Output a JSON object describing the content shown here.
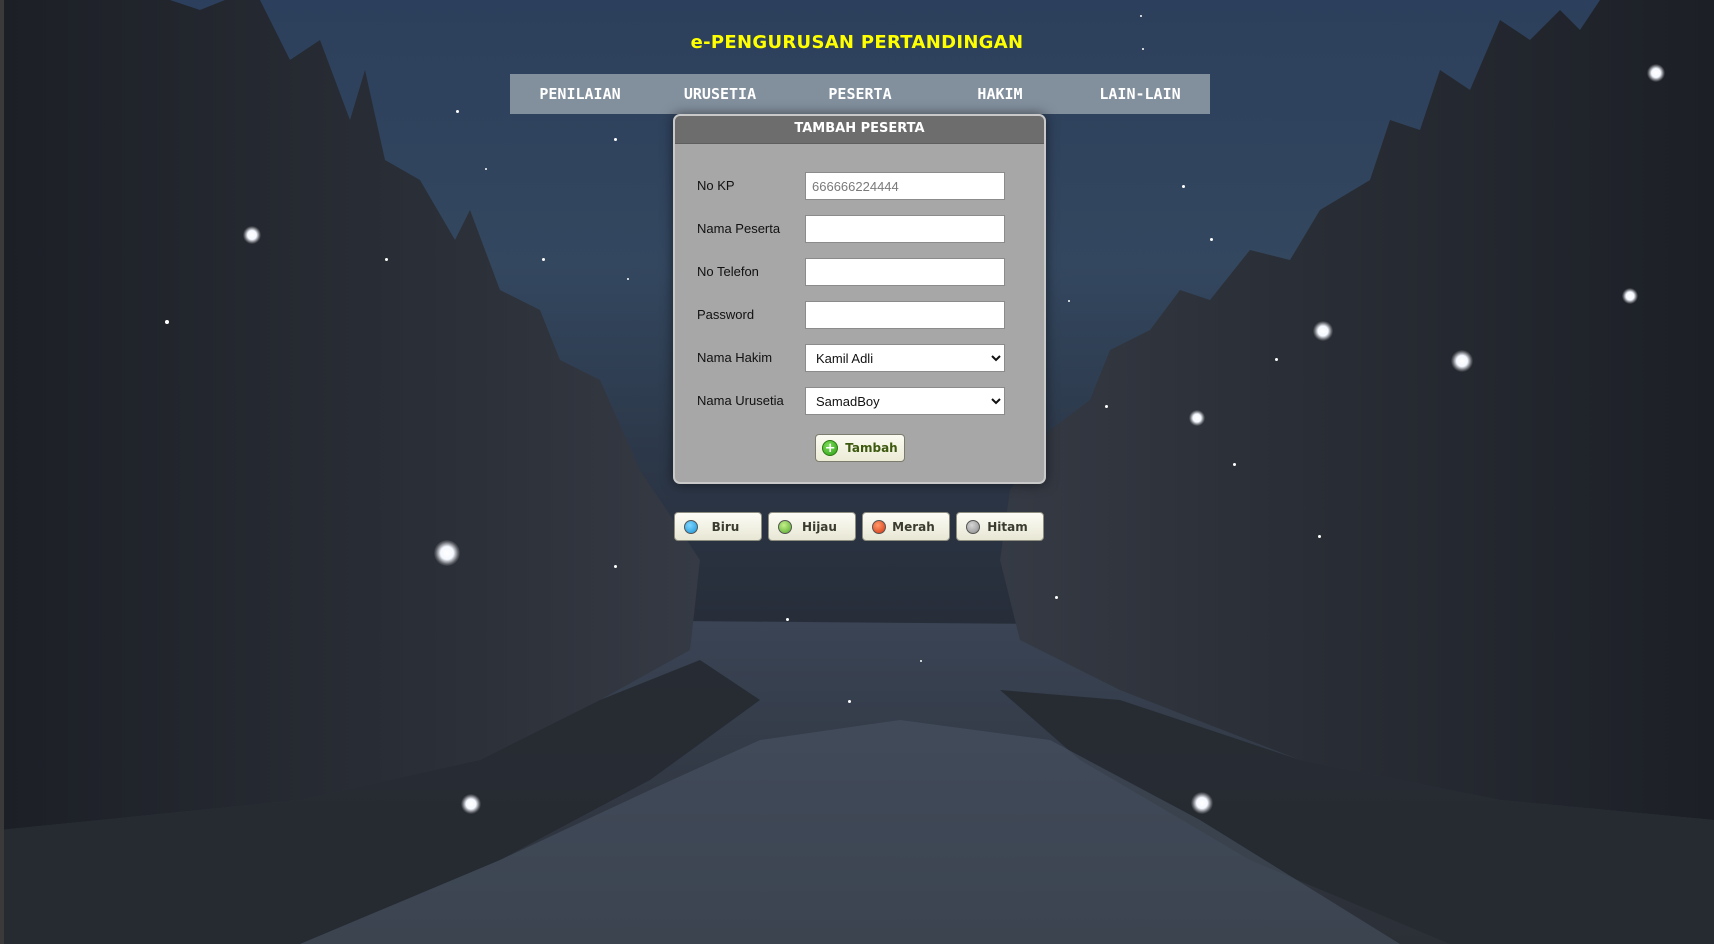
{
  "header": {
    "title": "e-PENGURUSAN PERTANDINGAN"
  },
  "nav": {
    "items": [
      {
        "label": "PENILAIAN"
      },
      {
        "label": "URUSETIA"
      },
      {
        "label": "PESERTA"
      },
      {
        "label": "HAKIM"
      },
      {
        "label": "LAIN-LAIN"
      }
    ]
  },
  "form": {
    "title": "TAMBAH PESERTA",
    "fields": {
      "no_kp": {
        "label": "No KP",
        "placeholder": "666666224444",
        "value": ""
      },
      "nama_peserta": {
        "label": "Nama Peserta",
        "value": ""
      },
      "no_telefon": {
        "label": "No Telefon",
        "value": ""
      },
      "password": {
        "label": "Password",
        "value": ""
      },
      "nama_hakim": {
        "label": "Nama Hakim",
        "selected": "Kamil Adli"
      },
      "nama_urusetia": {
        "label": "Nama Urusetia",
        "selected": "SamadBoy"
      }
    },
    "submit": {
      "label": "Tambah",
      "icon": "plus-circle-icon"
    }
  },
  "themes": [
    {
      "label": "Biru",
      "color": "#1ea7e6"
    },
    {
      "label": "Hijau",
      "color": "#6dc43c"
    },
    {
      "label": "Merah",
      "color": "#e8431a"
    },
    {
      "label": "Hitam",
      "color": "#9a9a9a"
    }
  ]
}
